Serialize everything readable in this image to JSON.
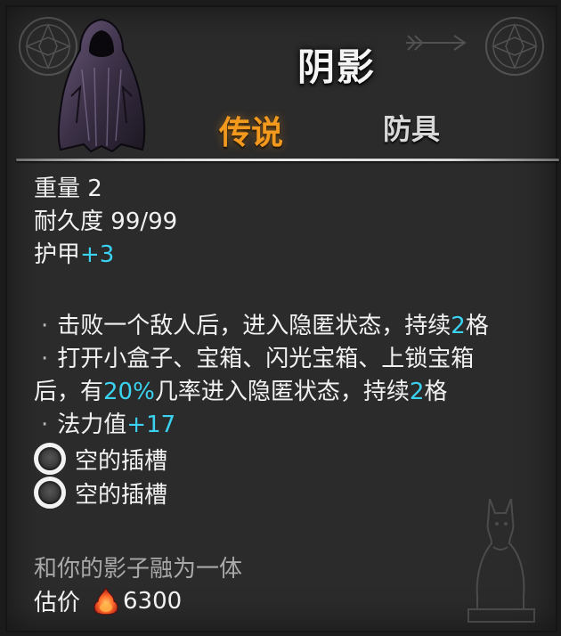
{
  "item": {
    "name": "阴影",
    "rarity": "传说",
    "category": "防具",
    "portrait_icon": "hooded-cloak-icon"
  },
  "stats": {
    "weight_label": "重量",
    "weight_value": "2",
    "durability_label": "耐久度",
    "durability_value": "99/99",
    "armor_label": "护甲",
    "armor_value": "+3"
  },
  "effects": {
    "bullet": "·",
    "effect1_pre": "击败一个敌人后，进入隐匿状态，持续",
    "effect1_num": "2",
    "effect1_post": "格",
    "effect2_line1": "打开小盒子、宝箱、闪光宝箱、上锁宝箱",
    "effect2_pre": "后，有",
    "effect2_pct": "20%",
    "effect2_mid": "几率进入隐匿状态，持续",
    "effect2_num": "2",
    "effect2_post": "格",
    "effect3_label": "法力值",
    "effect3_value": "+17"
  },
  "sockets": [
    {
      "label": "空的插槽"
    },
    {
      "label": "空的插槽"
    }
  ],
  "flavor_text": "和你的影子融为一体",
  "price": {
    "label": "估价",
    "value": "6300",
    "currency_icon": "fire-gem-icon"
  },
  "colors": {
    "rarity": "#f39a1e",
    "highlight": "#3ad2f0",
    "text": "#f2f2f2",
    "flavor": "#a9a9a9",
    "panel": "#2b2b2b"
  }
}
